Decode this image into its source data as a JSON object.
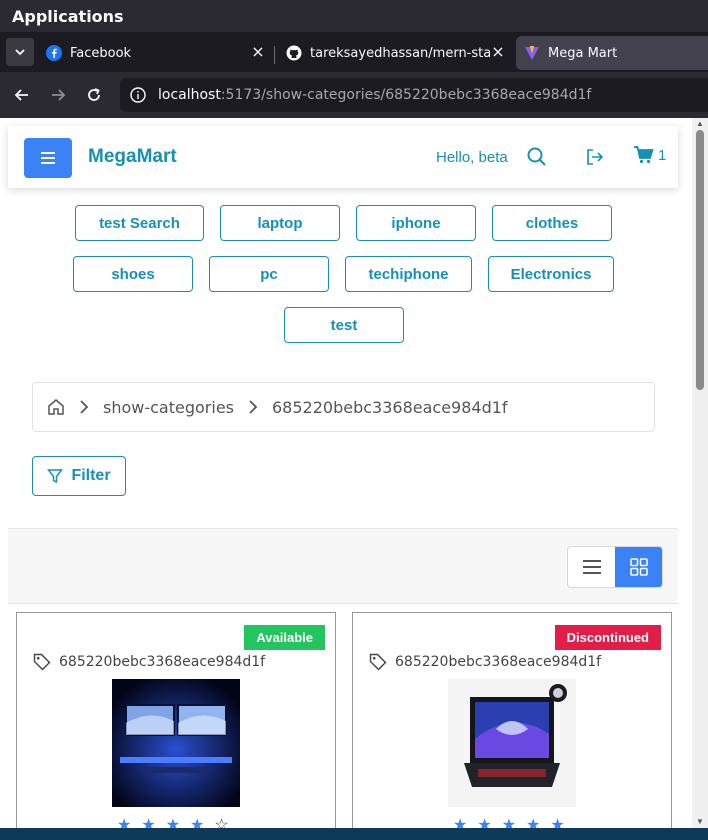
{
  "os": {
    "title": "Applications"
  },
  "tabs": [
    {
      "title": "Facebook",
      "icon": "facebook-icon"
    },
    {
      "title": "tareksayedhassan/mern-sta",
      "icon": "github-icon"
    },
    {
      "title": "Mega Mart",
      "icon": "vite-icon"
    }
  ],
  "url": {
    "host": "localhost",
    "path": ":5173/show-categories/685220bebc3368eace984d1f"
  },
  "header": {
    "brand": "MegaMart",
    "greeting": "Hello, beta",
    "cart_count": "1",
    "accent": "#1591b8",
    "primary": "#3b82f6"
  },
  "categories": [
    "test Search",
    "laptop",
    "iphone",
    "clothes",
    "shoes",
    "pc",
    "techiphone",
    "Electronics",
    "test"
  ],
  "breadcrumb": {
    "segment1": "show-categories",
    "segment2": "685220bebc3368eace984d1f"
  },
  "filter": {
    "label": "Filter"
  },
  "products": [
    {
      "status": "Available",
      "status_color": "#22c55e",
      "category_id": "685220bebc3368eace984d1f",
      "rating": 4
    },
    {
      "status": "Discontinued",
      "status_color": "#e11d48",
      "category_id": "685220bebc3368eace984d1f",
      "rating": 5
    }
  ]
}
